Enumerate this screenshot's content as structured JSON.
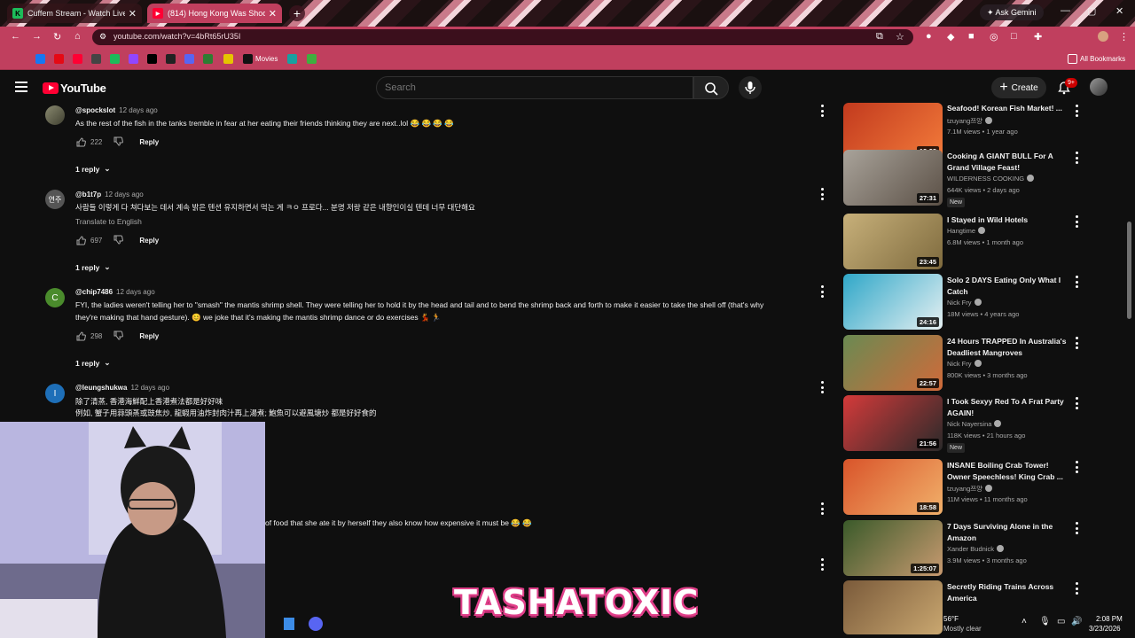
{
  "browser": {
    "tabs": [
      {
        "title": "Cuffem Stream - Watch Live on",
        "active": false
      },
      {
        "title": "(814) Hong Kong Was Shocked",
        "active": true
      }
    ],
    "ask_gemini": "Ask Gemini",
    "url": "youtube.com/watch?v=4bRt65rU35I",
    "bookmarks": {
      "movies": "Movies",
      "all": "All Bookmarks"
    }
  },
  "youtube": {
    "logo": "YouTube",
    "search_placeholder": "Search",
    "create": "Create",
    "notification_badge": "9+"
  },
  "comments": [
    {
      "handle": "@spockslot",
      "time": "12 days ago",
      "text": "As the rest of the fish in the tanks tremble in fear at her eating their friends thinking they are next..lol 😂 😂 😂 😂",
      "likes": "222",
      "reply": "Reply",
      "replies": "1 reply"
    },
    {
      "handle": "@b1t7p",
      "time": "12 days ago",
      "avatar": "연주",
      "text": "사람들 이렇게 다 쳐다보는 데서 계속 밝은 텐션 유지하면서 먹는 게 ㅋㅇ 프로다... 분명 저랑 같은 내향인이실 텐데 너무 대단해요",
      "translate": "Translate to English",
      "likes": "697",
      "reply": "Reply",
      "replies": "1 reply"
    },
    {
      "handle": "@chip7486",
      "time": "12 days ago",
      "avatar": "C",
      "text1": "FYI, the ladies weren't telling her to \"smash\" the mantis shrimp shell. They were telling her to hold it by the head and tail and to bend the shrimp back and forth to make it easier to take the shell off (that's why",
      "text2": "they're making that hand gesture). 😊 we joke that it's making the mantis shrimp dance or do exercises 💃 🏃",
      "likes": "298",
      "reply": "Reply",
      "replies": "1 reply"
    },
    {
      "handle": "@leungshukwa",
      "time": "12 days ago",
      "avatar": "I",
      "text1": "除了清蒸, 香港海鮮配上香港煮法都是好好味",
      "text2": "例如, 蟹子用蒜頭蒸或豉焦炒, 龍蝦用油炸封肉汁再上湯煮; 鮑魚可以避風塘炒 都是好好食的"
    },
    {
      "partial_text": "of food that she ate it by herself they also know how expensive it must be 😂 😂"
    }
  ],
  "videos": [
    {
      "title": "Seafood! Korean Fish Market! ...",
      "channel": "tzuyang쯔양",
      "views": "7.1M views",
      "age": "1 year ago",
      "duration": "18:28"
    },
    {
      "title": "Cooking A GIANT BULL For A Grand Village Feast!",
      "channel": "WILDERNESS COOKING",
      "views": "644K views",
      "age": "2 days ago",
      "duration": "27:31",
      "badge": "New"
    },
    {
      "title": "I Stayed in Wild Hotels",
      "channel": "Hangtime",
      "views": "6.8M views",
      "age": "1 month ago",
      "duration": "23:45"
    },
    {
      "title": "Solo 2 DAYS Eating Only What I Catch",
      "channel": "Nick Fry",
      "views": "18M views",
      "age": "4 years ago",
      "duration": "24:16"
    },
    {
      "title": "24 Hours TRAPPED In Australia's Deadliest Mangroves",
      "channel": "Nick Fry",
      "views": "800K views",
      "age": "3 months ago",
      "duration": "22:57"
    },
    {
      "title": "I Took Sexyy Red To A Frat Party AGAIN!",
      "channel": "Nick Nayersina",
      "views": "118K views",
      "age": "21 hours ago",
      "duration": "21:56",
      "badge": "New"
    },
    {
      "title": "INSANE Boiling Crab Tower! Owner Speechless! King Crab ...",
      "channel": "tzuyang쯔양",
      "views": "11M views",
      "age": "11 months ago",
      "duration": "18:58"
    },
    {
      "title": "7 Days Surviving Alone in the Amazon",
      "channel": "Xander Budnick",
      "views": "3.9M views",
      "age": "3 months ago",
      "duration": "1:25:07"
    },
    {
      "title": "Secretly Riding Trains Across America",
      "channel": "",
      "views": "",
      "age": "",
      "duration": ""
    }
  ],
  "overlay": {
    "name": "TASHATOXIC"
  },
  "taskbar": {
    "temp": "56°F",
    "weather": "Mostly clear",
    "time": "2:08 PM",
    "date": "3/23/2026"
  },
  "colors": {
    "accent": "#c03f5e",
    "yt_red": "#ff0033",
    "bg": "#0f0f0f"
  }
}
